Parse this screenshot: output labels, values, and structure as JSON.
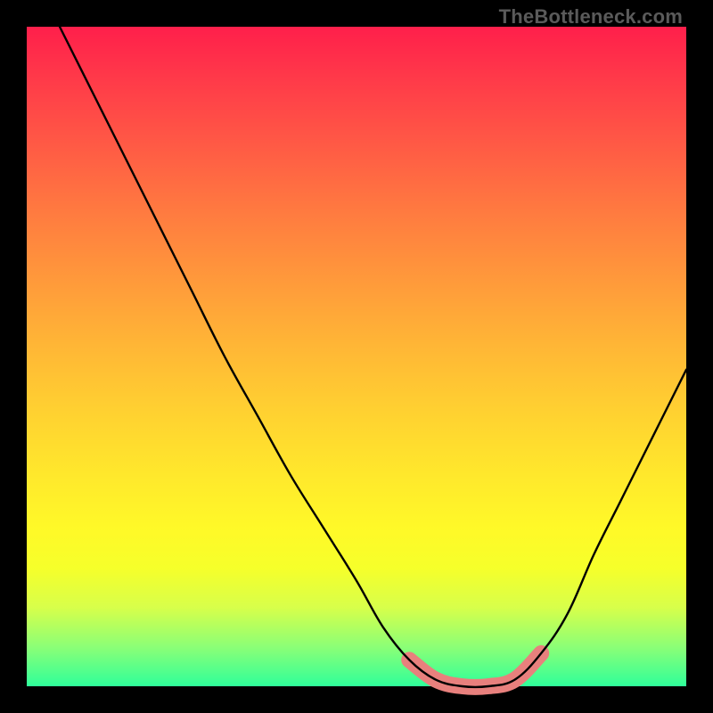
{
  "watermark": "TheBottleneck.com",
  "chart_data": {
    "type": "line",
    "title": "",
    "xlabel": "",
    "ylabel": "",
    "xlim": [
      0,
      100
    ],
    "ylim": [
      0,
      100
    ],
    "series": [
      {
        "name": "bottleneck-curve",
        "x": [
          5,
          10,
          15,
          20,
          25,
          30,
          35,
          40,
          45,
          50,
          54,
          58,
          62,
          66,
          70,
          74,
          78,
          82,
          86,
          90,
          95,
          100
        ],
        "values": [
          100,
          90,
          80,
          70,
          60,
          50,
          41,
          32,
          24,
          16,
          9,
          4,
          1,
          0,
          0,
          1,
          5,
          11,
          20,
          28,
          38,
          48
        ]
      },
      {
        "name": "optimal-band",
        "x": [
          58,
          62,
          66,
          70,
          74,
          78
        ],
        "values": [
          4,
          1,
          0,
          0,
          1,
          5
        ]
      }
    ],
    "annotations": [],
    "colors": {
      "curve": "#000000",
      "optimal_band": "#e8807d",
      "gradient_top": "#ff1f4b",
      "gradient_mid": "#ffe82c",
      "gradient_bottom": "#2fff9a",
      "background": "#000000",
      "watermark": "#5a5a5a"
    }
  }
}
